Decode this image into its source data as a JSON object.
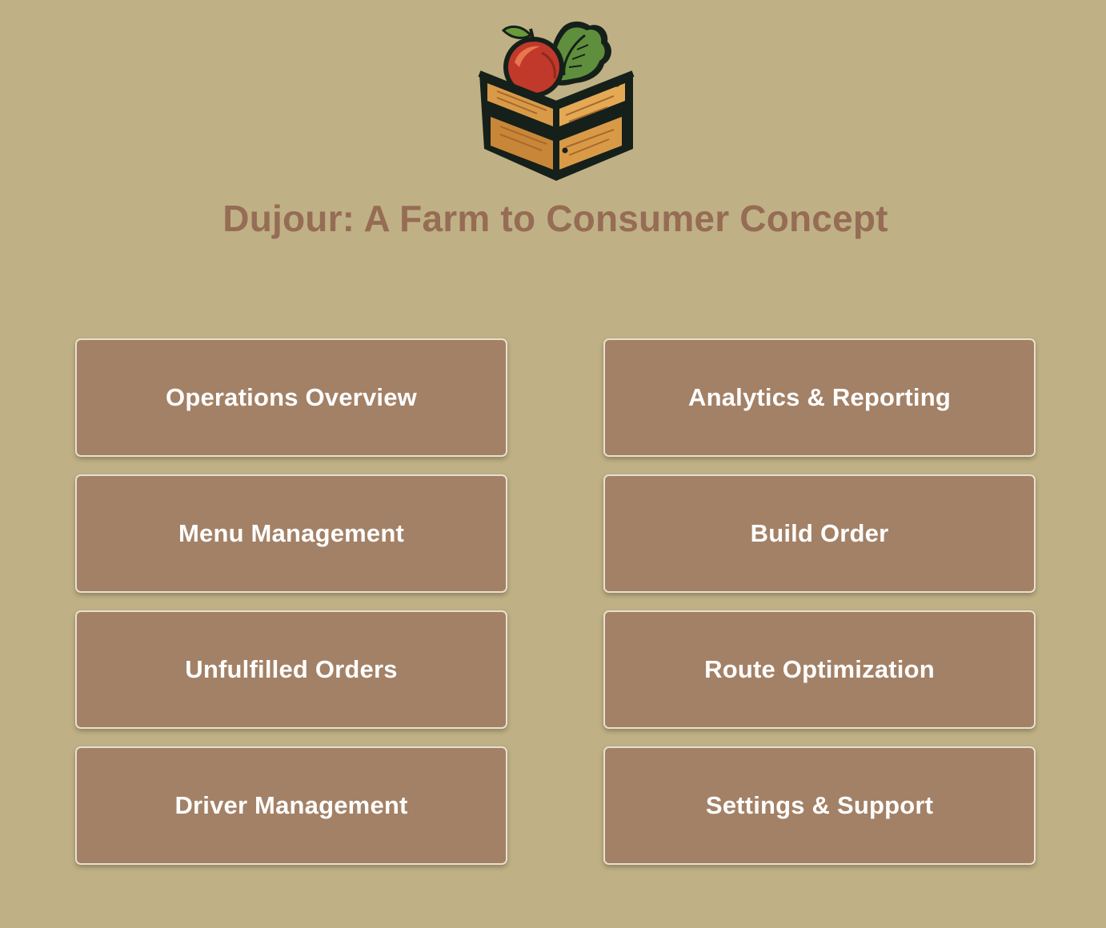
{
  "header": {
    "logo_icon": "produce-crate-icon",
    "title": "Dujour: A Farm to Consumer Concept"
  },
  "nav": {
    "left": [
      {
        "label": "Operations Overview"
      },
      {
        "label": "Menu Management"
      },
      {
        "label": "Unfulfilled Orders"
      },
      {
        "label": "Driver Management"
      }
    ],
    "right": [
      {
        "label": "Analytics & Reporting"
      },
      {
        "label": "Build Order"
      },
      {
        "label": "Route Optimization"
      },
      {
        "label": "Settings & Support"
      }
    ]
  },
  "colors": {
    "background": "#bfb185",
    "title": "#966c55",
    "card": "#a38166",
    "card_border": "#e9dfd0",
    "card_text": "#ffffff"
  }
}
